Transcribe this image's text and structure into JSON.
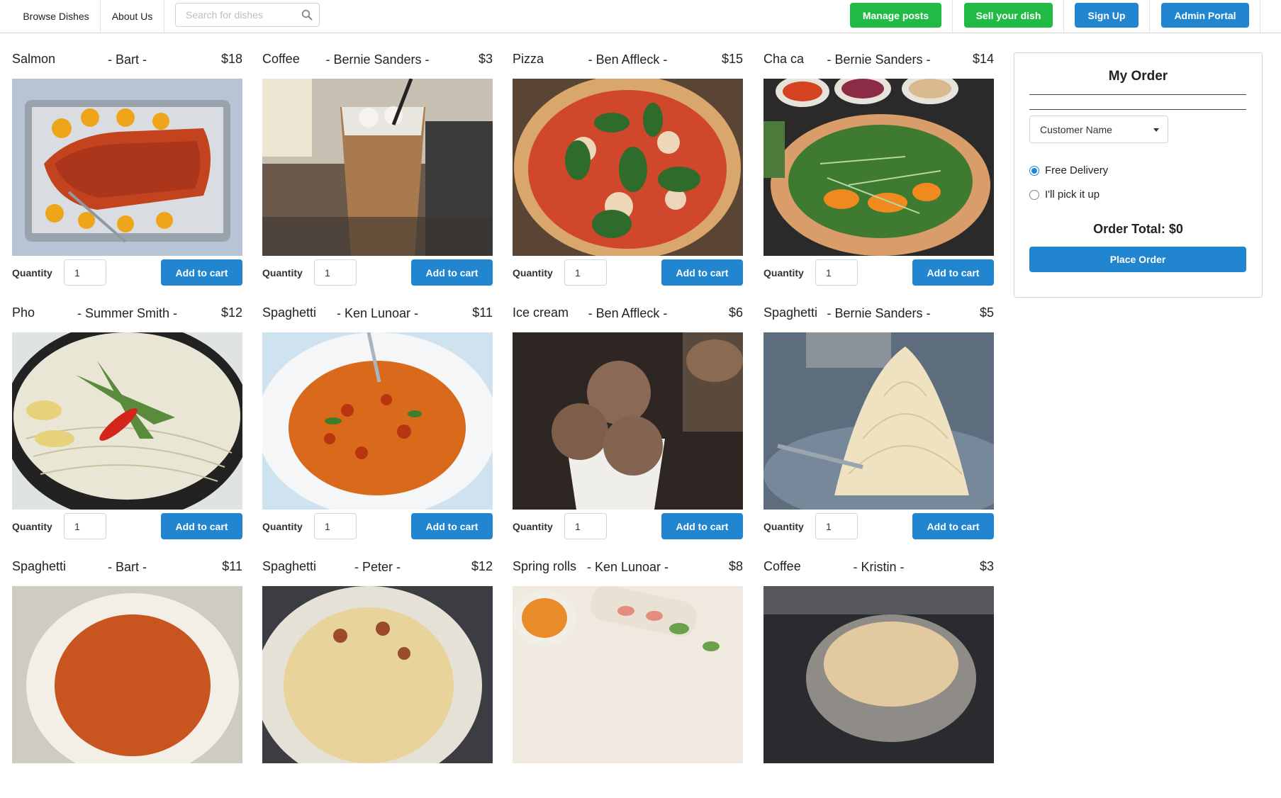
{
  "nav": {
    "browse_label": "Browse Dishes",
    "about_label": "About Us",
    "search_placeholder": "Search for dishes",
    "manage_label": "Manage posts",
    "sell_label": "Sell your dish",
    "signup_label": "Sign Up",
    "admin_label": "Admin Portal"
  },
  "colors": {
    "green": "#21ba45",
    "blue": "#2185d0"
  },
  "card_labels": {
    "quantity": "Quantity",
    "add_to_cart": "Add to cart"
  },
  "dishes": [
    {
      "name": "Salmon",
      "seller": "-   Bart  -",
      "price": "$18",
      "quantity": "1",
      "image": "salmon-photo"
    },
    {
      "name": "Coffee",
      "seller": "-   Bernie Sanders  -",
      "price": "$3",
      "quantity": "1",
      "image": "iced-coffee-photo"
    },
    {
      "name": "Pizza",
      "seller": "-   Ben Affleck  -",
      "price": "$15",
      "quantity": "1",
      "image": "pizza-photo"
    },
    {
      "name": "Cha ca",
      "seller": "-   Bernie Sanders  -",
      "price": "$14",
      "quantity": "1",
      "image": "cha-ca-photo"
    },
    {
      "name": "Pho",
      "seller": "-   Summer Smith  -",
      "price": "$12",
      "quantity": "1",
      "image": "pho-photo"
    },
    {
      "name": "Spaghetti",
      "seller": "-   Ken Lunoar  -",
      "price": "$11",
      "quantity": "1",
      "image": "spaghetti-bolognese-photo"
    },
    {
      "name": "Ice cream",
      "seller": "-   Ben Affleck  -",
      "price": "$6",
      "quantity": "1",
      "image": "ice-cream-photo"
    },
    {
      "name": "Spaghetti",
      "seller": "-   Bernie Sanders  -",
      "price": "$5",
      "quantity": "1",
      "image": "cacio-e-pepe-photo"
    },
    {
      "name": "Spaghetti",
      "seller": "-   Bart  -",
      "price": "$11",
      "quantity": "1",
      "image": "spaghetti-tomato-photo"
    },
    {
      "name": "Spaghetti",
      "seller": "-   Peter  -",
      "price": "$12",
      "quantity": "1",
      "image": "carbonara-photo"
    },
    {
      "name": "Spring rolls",
      "seller": "-   Ken Lunoar  -",
      "price": "$8",
      "quantity": "1",
      "image": "spring-rolls-photo"
    },
    {
      "name": "Coffee",
      "seller": "-   Kristin  -",
      "price": "$3",
      "quantity": "1",
      "image": "latte-photo"
    }
  ],
  "order": {
    "title": "My Order",
    "customer_placeholder": "Customer Name",
    "delivery_options": [
      {
        "label": "Free Delivery",
        "selected": true
      },
      {
        "label": "I'll pick it up",
        "selected": false
      }
    ],
    "total_label": "Order Total: $0",
    "place_order_label": "Place Order"
  }
}
